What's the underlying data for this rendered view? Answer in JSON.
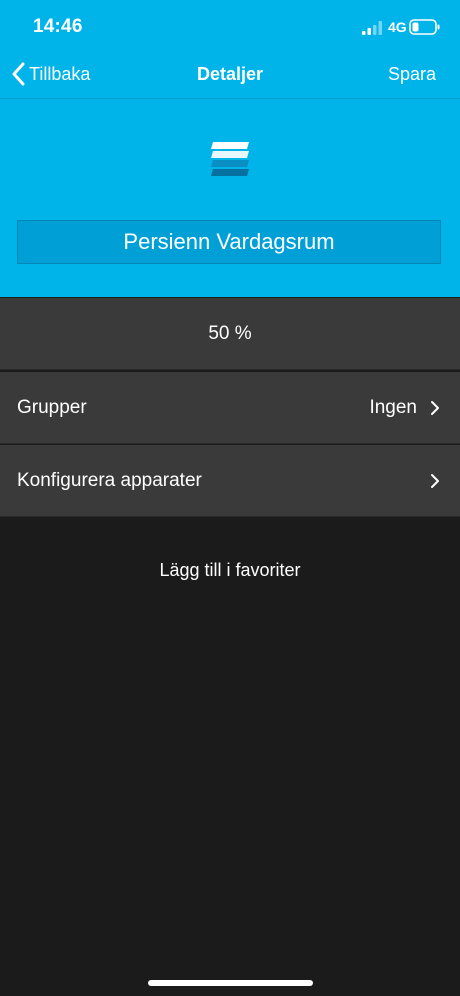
{
  "status_bar": {
    "time": "14:46",
    "network": "4G"
  },
  "nav": {
    "back_label": "Tillbaka",
    "title": "Detaljer",
    "save_label": "Spara"
  },
  "device": {
    "icon": "blinds-icon",
    "name": "Persienn Vardagsrum",
    "position": "50 %"
  },
  "settings": {
    "groups": {
      "label": "Grupper",
      "value": "Ingen"
    },
    "configure": {
      "label": "Konfigurera apparater"
    }
  },
  "favorites_label": "Lägg till i favoriter",
  "colors": {
    "accent": "#00b4ea",
    "row_background": "#3a3a3a",
    "background": "#1b1b1b"
  }
}
